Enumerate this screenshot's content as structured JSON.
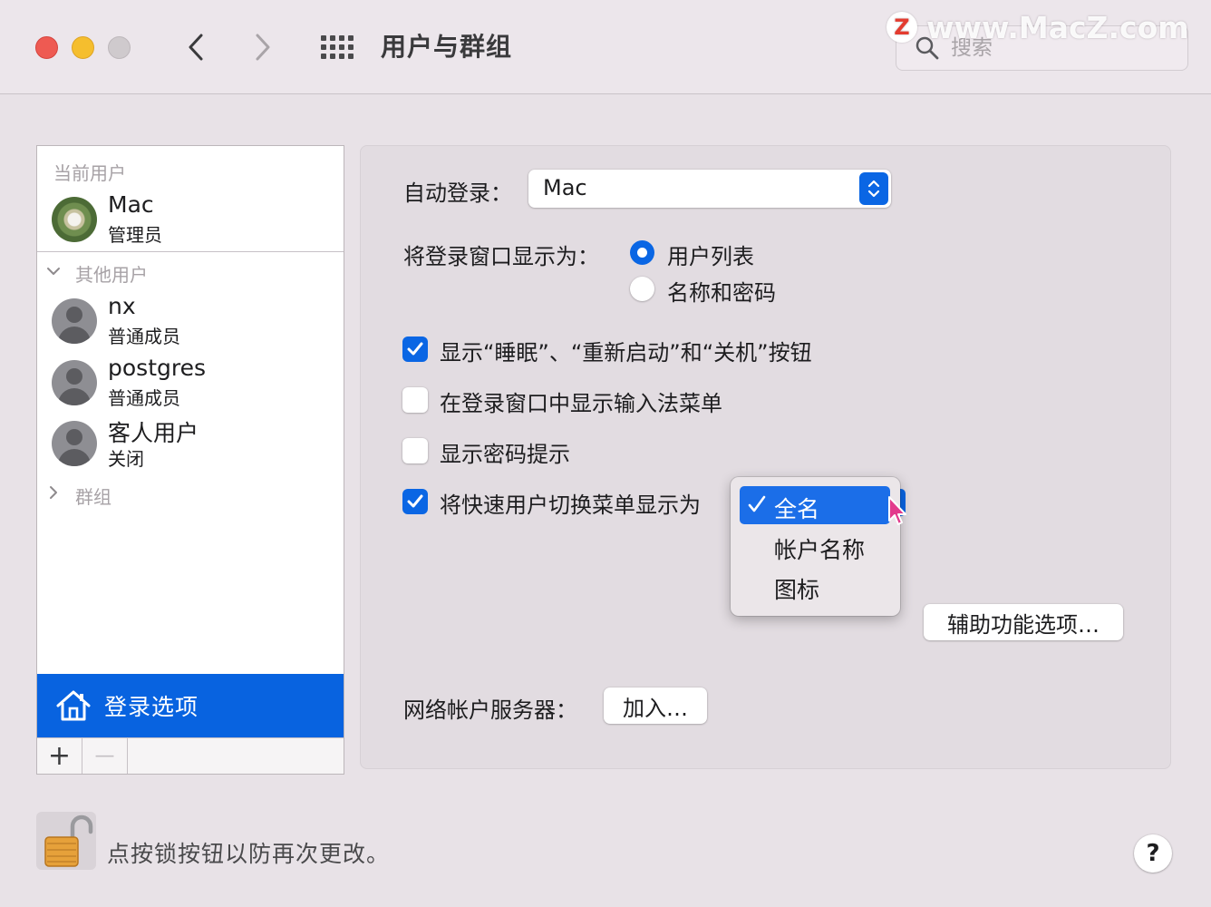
{
  "toolbar": {
    "title": "用户与群组",
    "search_placeholder": "搜索",
    "watermark_badge": "Z",
    "watermark_text": "www.MacZ.com"
  },
  "sidebar": {
    "current_users_label": "当前用户",
    "current_user": {
      "name": "Mac",
      "role": "管理员"
    },
    "other_users_label": "其他用户",
    "other_users": [
      {
        "name": "nx",
        "role": "普通成员"
      },
      {
        "name": "postgres",
        "role": "普通成员"
      },
      {
        "name": "客人用户",
        "role": "关闭"
      }
    ],
    "groups_label": "群组",
    "login_options_label": "登录选项",
    "add_button": "+",
    "remove_button": "—"
  },
  "panel": {
    "auto_login_label": "自动登录：",
    "auto_login_value": "Mac",
    "login_window_label": "将登录窗口显示为：",
    "radio_options": [
      {
        "label": "用户列表",
        "selected": true
      },
      {
        "label": "名称和密码",
        "selected": false
      }
    ],
    "checkboxes": [
      {
        "label": "显示“睡眠”、“重新启动”和“关机”按钮",
        "checked": true
      },
      {
        "label": "在登录窗口中显示输入法菜单",
        "checked": false
      },
      {
        "label": "显示密码提示",
        "checked": false
      },
      {
        "label": "将快速用户切换菜单显示为",
        "checked": true
      }
    ],
    "fast_switch_menu": [
      {
        "label": "全名",
        "selected": true
      },
      {
        "label": "帐户名称",
        "selected": false
      },
      {
        "label": "图标",
        "selected": false
      }
    ],
    "accessibility_button": "辅助功能选项…",
    "network_server_label": "网络帐户服务器：",
    "join_button": "加入…"
  },
  "footer": {
    "lock_text": "点按锁按钮以防再次更改。",
    "help_button": "?"
  },
  "colors": {
    "accent": "#0a66e4",
    "selection": "#0863e0",
    "close": "#ee5a52",
    "minimize": "#f5be2e"
  }
}
